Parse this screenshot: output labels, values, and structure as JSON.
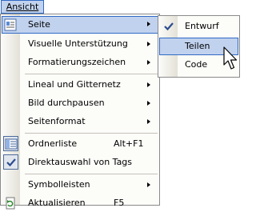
{
  "menubar": {
    "title": "Ansicht"
  },
  "menu": {
    "seite": "Seite",
    "visuelle": "Visuelle Unterstützung",
    "format": "Formatierungszeichen",
    "lineal": "Lineal und Gitternetz",
    "bild": "Bild durchpausen",
    "seitenformat": "Seitenformat",
    "ordnerliste": "Ordnerliste",
    "ordnerliste_shortcut": "Alt+F1",
    "direkt": "Direktauswahl von Tags",
    "symbolleisten": "Symbolleisten",
    "aktualisieren": "Aktualisieren",
    "aktualisieren_shortcut": "F5"
  },
  "submenu": {
    "entwurf": "Entwurf",
    "teilen": "Teilen",
    "code": "Code"
  },
  "icons": {
    "seite": "page-icon",
    "ordnerliste": "folder-list-icon",
    "direkt": "check-icon",
    "aktualisieren": "refresh-icon",
    "entwurf": "check-icon",
    "cursor": "mouse-cursor-icon"
  },
  "colors": {
    "highlight": "#c1d2ee",
    "highlight_border": "#316ac5",
    "check": "#3a5aa8"
  }
}
